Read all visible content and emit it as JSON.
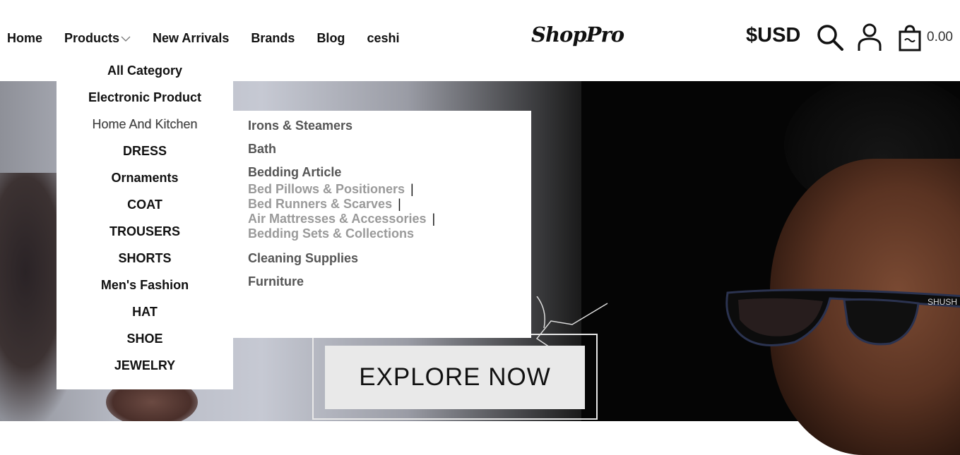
{
  "header": {
    "nav": [
      "Home",
      "Products",
      "New Arrivals",
      "Brands",
      "Blog",
      "ceshi"
    ],
    "logo": "ShopPro",
    "currency": "$USD",
    "cart_total": "0.00",
    "icons": [
      "search-icon",
      "user-icon",
      "cart-icon",
      "chevron-down-icon"
    ]
  },
  "products_menu": {
    "categories": [
      "All Category",
      "Electronic Product",
      "Home And Kitchen",
      "DRESS",
      "Ornaments",
      "COAT",
      "TROUSERS",
      "SHORTS",
      "Men's Fashion",
      "HAT",
      "SHOE",
      "JEWELRY"
    ],
    "active": "Home And Kitchen"
  },
  "submenu": {
    "groups": [
      {
        "title": "Irons & Steamers"
      },
      {
        "title": "Bath"
      },
      {
        "title": "Bedding Article",
        "links": [
          "Bed Pillows & Positioners",
          "Bed Runners & Scarves",
          "Air Mattresses & Accessories",
          "Bedding Sets & Collections"
        ],
        "separator": "|"
      },
      {
        "title": "Cleaning Supplies"
      },
      {
        "title": "Furniture"
      }
    ]
  },
  "hero": {
    "cta": "EXPLORE NOW",
    "glasses_text": "SHUSH"
  },
  "colors": {
    "text": "#111111",
    "muted": "#9a9a9a",
    "button_bg": "#e9e9e9"
  }
}
